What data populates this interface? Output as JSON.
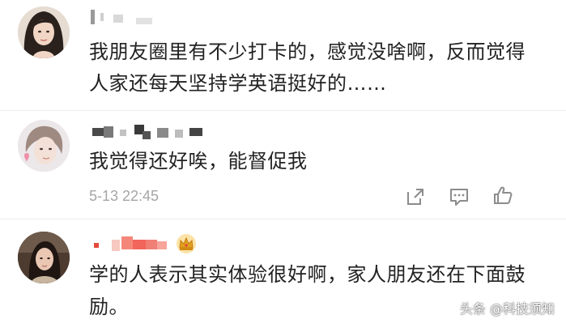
{
  "comments": [
    {
      "text_lines": [
        "我朋友圈里有不少打卡的，感觉没啥啊，反而觉得",
        "人家还每天坚持学英语挺好的……"
      ]
    },
    {
      "text_lines": [
        "我觉得还好唉，能督促我"
      ],
      "timestamp": "5-13 22:45",
      "actions": [
        "share-icon",
        "comment-icon",
        "like-icon"
      ]
    },
    {
      "text_lines": [
        "学的人表示其实体验很好啊，家人朋友还在下面鼓",
        "励。"
      ],
      "badge": "crown-icon"
    }
  ],
  "watermark": "头条 @科技须知",
  "colors": {
    "text": "#222222",
    "timestamp": "#a6a6a6",
    "icon": "#8c8c8c",
    "divider": "#ececec",
    "crown": "#e0a020",
    "name_blur": "#f2655a"
  }
}
